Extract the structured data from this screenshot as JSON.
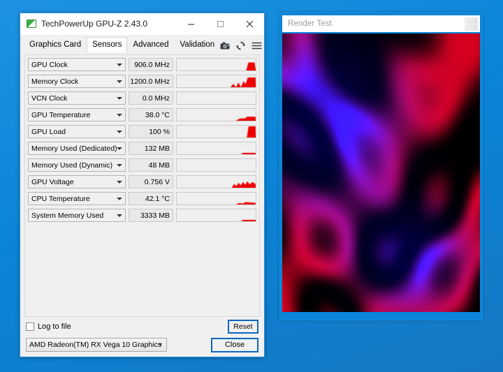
{
  "desktop": {
    "background_color": "#0b84d8"
  },
  "render_window": {
    "title": "Render Test",
    "close_button_label": "",
    "canvas_name": "plasma-render-canvas"
  },
  "gpuz": {
    "title": "TechPowerUp GPU-Z 2.43.0",
    "app_icon": "gpuz-logo-icon",
    "window_buttons": {
      "minimize": "minimize-icon",
      "maximize": "maximize-icon",
      "close": "close-icon"
    },
    "tabs": [
      {
        "label": "Graphics Card",
        "active": false
      },
      {
        "label": "Sensors",
        "active": true
      },
      {
        "label": "Advanced",
        "active": false
      },
      {
        "label": "Validation",
        "active": false
      }
    ],
    "toolbar_icons": [
      {
        "name": "camera-icon"
      },
      {
        "name": "refresh-icon"
      },
      {
        "name": "menu-icon"
      }
    ],
    "sensors": [
      {
        "name": "GPU Clock",
        "value": "906.0 MHz",
        "graph": "bar-tall-right"
      },
      {
        "name": "Memory Clock",
        "value": "1200.0 MHz",
        "graph": "bars-stepped"
      },
      {
        "name": "VCN Clock",
        "value": "0.0 MHz",
        "graph": "empty"
      },
      {
        "name": "GPU Temperature",
        "value": "38.0 °C",
        "graph": "low-step"
      },
      {
        "name": "GPU Load",
        "value": "100 %",
        "graph": "full-bar"
      },
      {
        "name": "Memory Used (Dedicated)",
        "value": "132 MB",
        "graph": "flat-line"
      },
      {
        "name": "Memory Used (Dynamic)",
        "value": "48 MB",
        "graph": "empty"
      },
      {
        "name": "GPU Voltage",
        "value": "0.756 V",
        "graph": "spiky"
      },
      {
        "name": "CPU Temperature",
        "value": "42.1 °C",
        "graph": "low-bump"
      },
      {
        "name": "System Memory Used",
        "value": "3333 MB",
        "graph": "flat-line"
      }
    ],
    "log_to_file": {
      "label": "Log to file",
      "checked": false
    },
    "reset_button": "Reset",
    "gpu_selector": {
      "value": "AMD Radeon(TM) RX Vega 10 Graphics"
    },
    "close_button": "Close"
  },
  "colors": {
    "accent_blue": "#0a68c0",
    "graph_red": "#f00000",
    "window_border": "#2a8fd8"
  }
}
